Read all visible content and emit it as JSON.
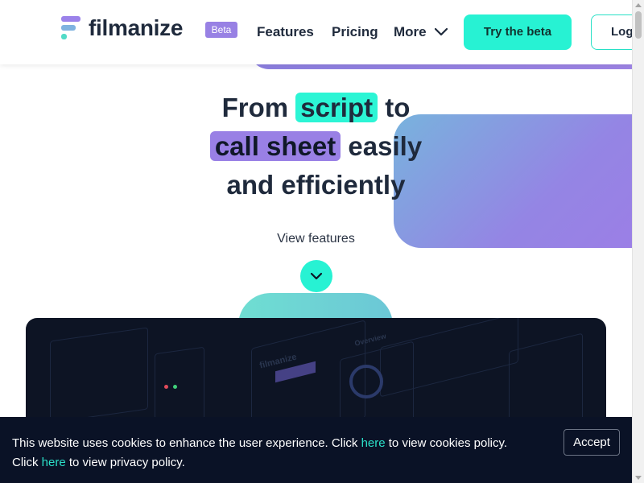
{
  "header": {
    "brand": "filmanize",
    "beta_badge": "Beta",
    "nav": {
      "features": "Features",
      "pricing": "Pricing",
      "more": "More"
    },
    "try_beta": "Try the beta",
    "login": "Log"
  },
  "hero": {
    "line1_pre": "From",
    "line1_highlight": "script",
    "line1_post": "to",
    "line2_highlight": "call sheet",
    "line2_post": "easily",
    "line3": "and efficiently",
    "view_features": "View features"
  },
  "preview": {
    "brand": "filmanize",
    "overview": "Overview"
  },
  "cookie": {
    "text1": "This website uses cookies to enhance the user experience. Click ",
    "link1": "here",
    "text2": " to view cookies policy.",
    "text3": "Click ",
    "link2": "here",
    "text4": " to view privacy policy.",
    "accept": "Accept"
  },
  "colors": {
    "accent_teal": "#27f2d3",
    "accent_purple": "#9980e5",
    "text_dark": "#1f2a3c",
    "banner_bg": "#0a1226"
  },
  "icons": [
    "logo-mark-icon",
    "chevron-down-icon",
    "arrow-down-circle-icon"
  ]
}
